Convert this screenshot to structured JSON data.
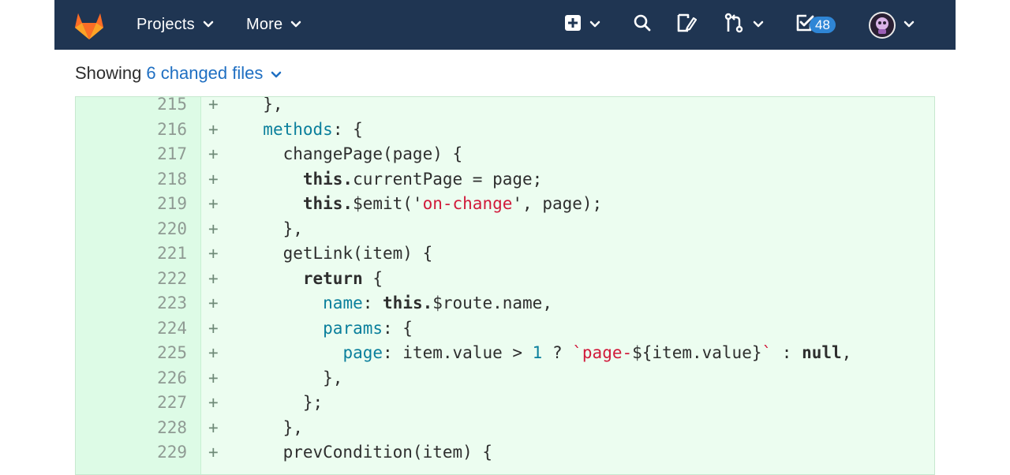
{
  "navbar": {
    "projects_label": "Projects",
    "more_label": "More",
    "todos_count": "48",
    "colors": {
      "background": "#1f3552",
      "badge": "#2f86d6",
      "logo_orange": "#fc6d26"
    },
    "icons": [
      "gitlab-logo-icon",
      "plus-square-icon",
      "search-icon",
      "issues-icon",
      "merge-request-icon",
      "todo-check-icon",
      "avatar"
    ]
  },
  "files_bar": {
    "prefix": "Showing",
    "link": "6 changed files"
  },
  "diff": {
    "lines": [
      {
        "num": "215",
        "sign": "+",
        "segments": [
          {
            "t": "  },",
            "c": "p"
          }
        ]
      },
      {
        "num": "216",
        "sign": "+",
        "segments": [
          {
            "t": "  ",
            "c": "p"
          },
          {
            "t": "methods",
            "c": "prop"
          },
          {
            "t": ": {",
            "c": "p"
          }
        ]
      },
      {
        "num": "217",
        "sign": "+",
        "segments": [
          {
            "t": "    changePage(page) {",
            "c": "p"
          }
        ]
      },
      {
        "num": "218",
        "sign": "+",
        "segments": [
          {
            "t": "      ",
            "c": "p"
          },
          {
            "t": "this.",
            "c": "kw"
          },
          {
            "t": "currentPage = page;",
            "c": "p"
          }
        ]
      },
      {
        "num": "219",
        "sign": "+",
        "segments": [
          {
            "t": "      ",
            "c": "p"
          },
          {
            "t": "this.",
            "c": "kw"
          },
          {
            "t": "$emit('",
            "c": "p"
          },
          {
            "t": "on-change",
            "c": "str"
          },
          {
            "t": "', page);",
            "c": "p"
          }
        ]
      },
      {
        "num": "220",
        "sign": "+",
        "segments": [
          {
            "t": "    },",
            "c": "p"
          }
        ]
      },
      {
        "num": "221",
        "sign": "+",
        "segments": [
          {
            "t": "    getLink(item) {",
            "c": "p"
          }
        ]
      },
      {
        "num": "222",
        "sign": "+",
        "segments": [
          {
            "t": "      ",
            "c": "p"
          },
          {
            "t": "return",
            "c": "kw"
          },
          {
            "t": " {",
            "c": "p"
          }
        ]
      },
      {
        "num": "223",
        "sign": "+",
        "segments": [
          {
            "t": "        ",
            "c": "p"
          },
          {
            "t": "name",
            "c": "prop"
          },
          {
            "t": ": ",
            "c": "p"
          },
          {
            "t": "this.",
            "c": "kw"
          },
          {
            "t": "$route.name,",
            "c": "p"
          }
        ]
      },
      {
        "num": "224",
        "sign": "+",
        "segments": [
          {
            "t": "        ",
            "c": "p"
          },
          {
            "t": "params",
            "c": "prop"
          },
          {
            "t": ": {",
            "c": "p"
          }
        ]
      },
      {
        "num": "225",
        "sign": "+",
        "segments": [
          {
            "t": "          ",
            "c": "p"
          },
          {
            "t": "page",
            "c": "prop"
          },
          {
            "t": ": item.value > ",
            "c": "p"
          },
          {
            "t": "1",
            "c": "num"
          },
          {
            "t": " ? ",
            "c": "p"
          },
          {
            "t": "`page-",
            "c": "str"
          },
          {
            "t": "${item.value}",
            "c": "p"
          },
          {
            "t": "`",
            "c": "str"
          },
          {
            "t": " : ",
            "c": "p"
          },
          {
            "t": "null",
            "c": "kw"
          },
          {
            "t": ",",
            "c": "p"
          }
        ]
      },
      {
        "num": "226",
        "sign": "+",
        "segments": [
          {
            "t": "        },",
            "c": "p"
          }
        ]
      },
      {
        "num": "227",
        "sign": "+",
        "segments": [
          {
            "t": "      };",
            "c": "p"
          }
        ]
      },
      {
        "num": "228",
        "sign": "+",
        "segments": [
          {
            "t": "    },",
            "c": "p"
          }
        ]
      },
      {
        "num": "229",
        "sign": "+",
        "segments": [
          {
            "t": "    prevCondition(item) {",
            "c": "p"
          }
        ]
      }
    ]
  }
}
